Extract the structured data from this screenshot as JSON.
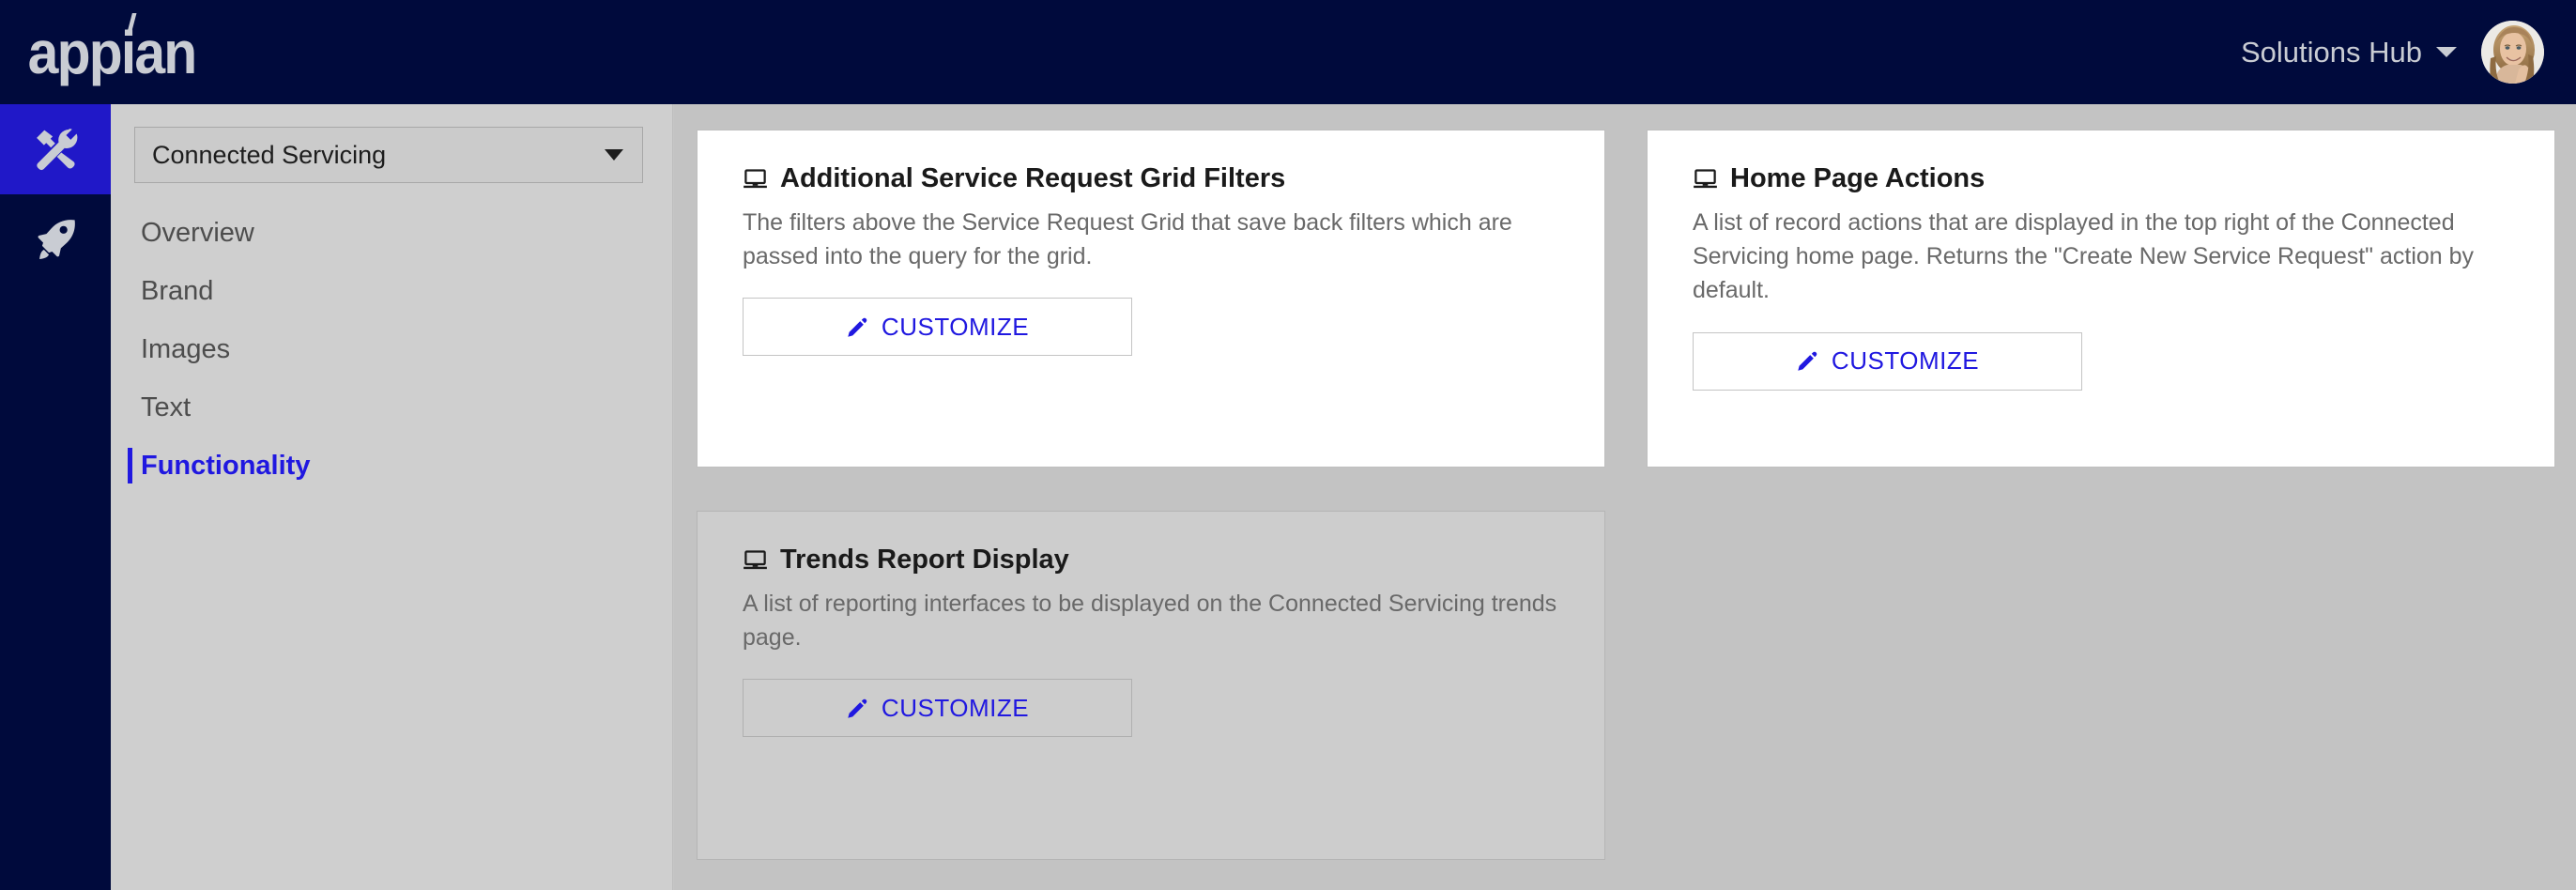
{
  "header": {
    "logo_text": "appian",
    "logo_letters": {
      "a1": "app",
      "i": "i",
      "an": "an"
    },
    "hub_label": "Solutions Hub",
    "caret_icon": "chevron-down-icon",
    "avatar_alt": "User profile photo"
  },
  "rail": {
    "items": [
      {
        "icon": "tools-icon",
        "label": "Tools",
        "active": true
      },
      {
        "icon": "rocket-icon",
        "label": "Launch",
        "active": false
      }
    ]
  },
  "nav": {
    "app_select": {
      "value": "Connected Servicing",
      "caret_icon": "caret-down-icon"
    },
    "items": [
      {
        "label": "Overview",
        "active": false
      },
      {
        "label": "Brand",
        "active": false
      },
      {
        "label": "Images",
        "active": false
      },
      {
        "label": "Text",
        "active": false
      },
      {
        "label": "Functionality",
        "active": true
      }
    ]
  },
  "cards": [
    {
      "icon": "laptop-icon",
      "title": "Additional Service Request Grid Filters",
      "description": "The filters above the Service Request Grid that save back filters which are passed into the query for the grid.",
      "button_label": "CUSTOMIZE",
      "button_icon": "pencil-icon"
    },
    {
      "icon": "laptop-icon",
      "title": "Home Page Actions",
      "description": "A list of record actions that are displayed in the top right of the Connected Servicing home page. Returns the \"Create New Service Request\" action by default.",
      "button_label": "CUSTOMIZE",
      "button_icon": "pencil-icon"
    },
    {
      "icon": "laptop-icon",
      "title": "Trends Report Display",
      "description": "A list of reporting interfaces to be displayed on the Connected Servicing trends page.",
      "button_label": "CUSTOMIZE",
      "button_icon": "pencil-icon"
    }
  ],
  "colors": {
    "header_bg": "#000a3c",
    "rail_active": "#2018c8",
    "accent_blue": "#2018e0",
    "page_bg": "#c3c3c3",
    "nav_bg": "#cfcfcf",
    "card_bg": "#ffffff",
    "card_disabled_bg": "#cdcdcd",
    "logo_gray": "#c9ccd3"
  }
}
